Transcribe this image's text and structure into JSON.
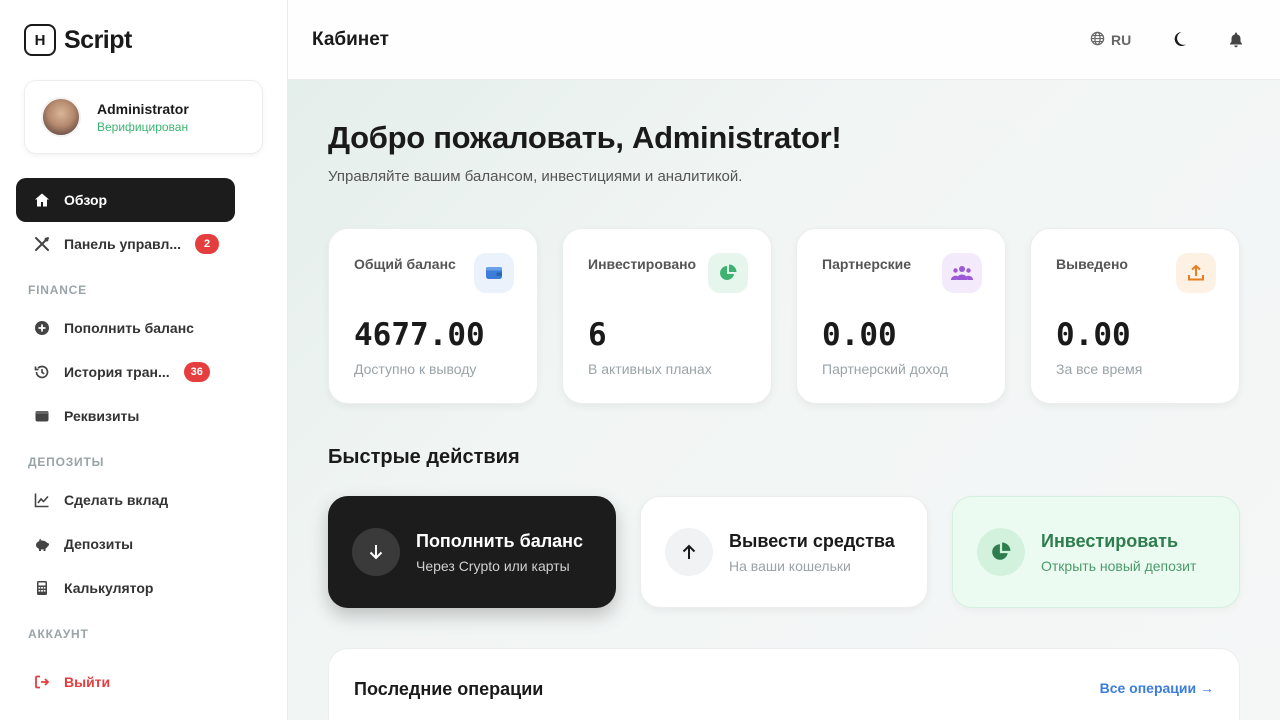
{
  "brand": {
    "logo_letter": "H",
    "name": "Script"
  },
  "user": {
    "name": "Administrator",
    "status": "Верифицирован"
  },
  "sidebar": {
    "items": [
      {
        "label": "Обзор",
        "icon": "home-icon"
      },
      {
        "label": "Панель управл...",
        "icon": "tools-icon",
        "badge": "2"
      },
      {
        "label": "Пополнить баланс",
        "icon": "plus-circle-icon"
      },
      {
        "label": "История тран...",
        "icon": "history-icon",
        "badge": "36"
      },
      {
        "label": "Реквизиты",
        "icon": "wallet-icon"
      },
      {
        "label": "Сделать вклад",
        "icon": "chart-line-icon"
      },
      {
        "label": "Депозиты",
        "icon": "piggy-bank-icon"
      },
      {
        "label": "Калькулятор",
        "icon": "calculator-icon"
      },
      {
        "label": "Выйти",
        "icon": "logout-icon"
      }
    ],
    "sections": [
      "FINANCE",
      "ДЕПОЗИТЫ",
      "АККАУНТ"
    ]
  },
  "header": {
    "title": "Кабинет",
    "lang": "RU"
  },
  "main": {
    "welcome": "Добро пожаловать, Administrator!",
    "subtitle": "Управляйте вашим балансом, инвестициями и аналитикой.",
    "stats": [
      {
        "label": "Общий баланс",
        "value": "4677.00",
        "sub": "Доступно к выводу",
        "icon": "wallet-icon",
        "color": "#3b7dd8"
      },
      {
        "label": "Инвестировано",
        "value": "6",
        "sub": "В активных планах",
        "icon": "pie-chart-icon",
        "color": "#3cb371"
      },
      {
        "label": "Партнерские",
        "value": "0.00",
        "sub": "Партнерский доход",
        "icon": "users-icon",
        "color": "#9b59d6"
      },
      {
        "label": "Выведено",
        "value": "0.00",
        "sub": "За все время",
        "icon": "upload-icon",
        "color": "#e67e22"
      }
    ],
    "quick_title": "Быстрые действия",
    "actions": [
      {
        "title": "Пополнить баланс",
        "sub": "Через Crypto или карты",
        "icon": "arrow-down-icon"
      },
      {
        "title": "Вывести средства",
        "sub": "На ваши кошельки",
        "icon": "arrow-up-icon"
      },
      {
        "title": "Инвестировать",
        "sub": "Открыть новый депозит",
        "icon": "pie-chart-icon"
      }
    ],
    "recent_title": "Последние операции",
    "recent_link": "Все операции →"
  }
}
